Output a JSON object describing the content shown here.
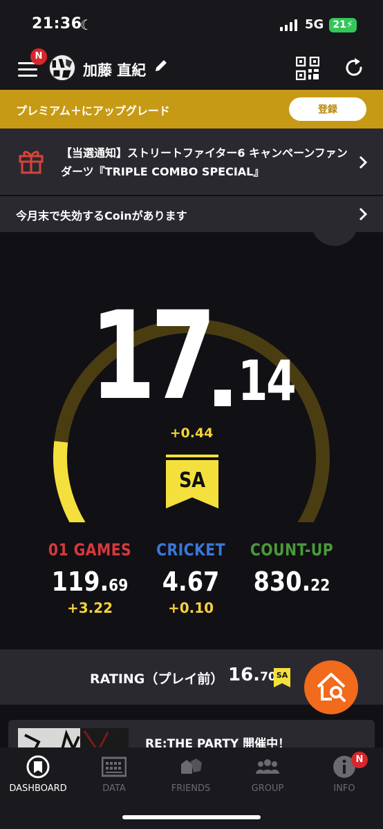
{
  "status_bar": {
    "time": "21:36",
    "network": "5G",
    "battery": "21"
  },
  "header": {
    "menu_badge": "N",
    "username": "加藤 直紀"
  },
  "premium": {
    "label": "プレミアム＋にアップグレード",
    "button": "登録"
  },
  "notice": {
    "text": "【当選通知】ストリートファイター6 キャンペーンファンダーツ『TRIPLE COMBO SPECIAL』"
  },
  "coin_notice": {
    "text": "今月末で失効するCoinがあります"
  },
  "rating": {
    "integer": "17",
    "decimal": "14",
    "diff": "+0.44",
    "grade": "SA",
    "gauge_progress": 0.18
  },
  "stats": [
    {
      "name": "01 GAMES",
      "int": "119.",
      "dec": "69",
      "diff": "+3.22",
      "color": "#d8383c"
    },
    {
      "name": "CRICKET",
      "int": "4.67",
      "dec": "",
      "diff": "+0.10",
      "color": "#3a78d8"
    },
    {
      "name": "COUNT-UP",
      "int": "830.",
      "dec": "22",
      "diff": "",
      "color": "#4a9a3a"
    }
  ],
  "rating_bar": {
    "label": "RATING（プレイ前）",
    "int": "16.",
    "dec": "70",
    "grade": "SA"
  },
  "event": {
    "title": "RE:THE PARTY 開催中！"
  },
  "tabs": [
    {
      "label": "DASHBOARD",
      "icon": "dashboard-icon"
    },
    {
      "label": "DATA",
      "icon": "data-icon"
    },
    {
      "label": "FRIENDS",
      "icon": "friends-icon"
    },
    {
      "label": "GROUP",
      "icon": "group-icon"
    },
    {
      "label": "INFO",
      "icon": "info-icon"
    }
  ],
  "info_badge": "N",
  "colors": {
    "accent": "#f4e03c",
    "premium": "#c79a15",
    "fab": "#f26a1b",
    "badge": "#d8262c"
  }
}
